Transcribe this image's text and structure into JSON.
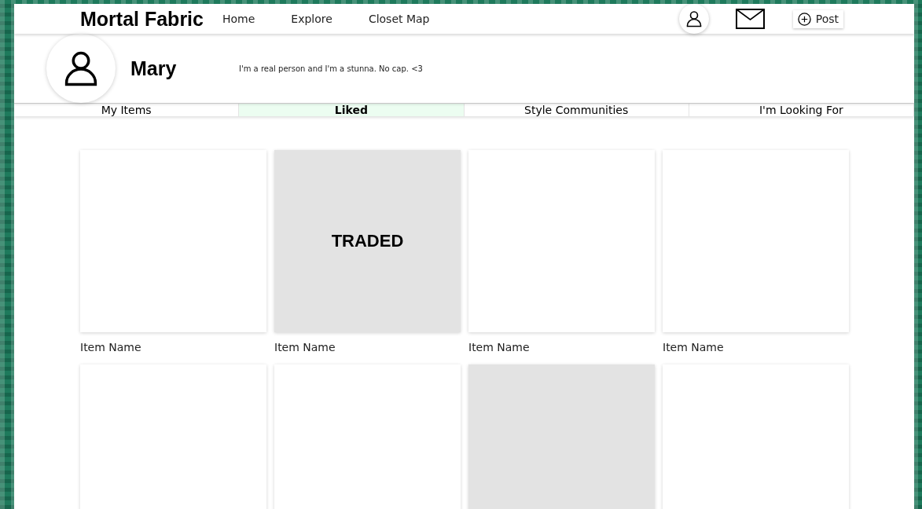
{
  "header": {
    "logo": "Mortal Fabric",
    "nav": [
      "Home",
      "Explore",
      "Closet Map"
    ],
    "post_button": "Post"
  },
  "profile": {
    "name": "Mary",
    "bio": "I'm a real person and I'm a stunna. No cap. <3"
  },
  "tabs": [
    {
      "label": "My Items",
      "selected": false
    },
    {
      "label": "Liked",
      "selected": true
    },
    {
      "label": "Style Communities",
      "selected": false
    },
    {
      "label": "I'm Looking For",
      "selected": false
    }
  ],
  "items": [
    {
      "traded": false,
      "name": "Item Name"
    },
    {
      "traded": true,
      "badge": "TRADED",
      "name": "Item Name"
    },
    {
      "traded": false,
      "name": "Item Name"
    },
    {
      "traded": false,
      "name": "Item Name"
    },
    {
      "traded": false
    },
    {
      "traded": false
    },
    {
      "traded": true
    },
    {
      "traded": false
    }
  ]
}
